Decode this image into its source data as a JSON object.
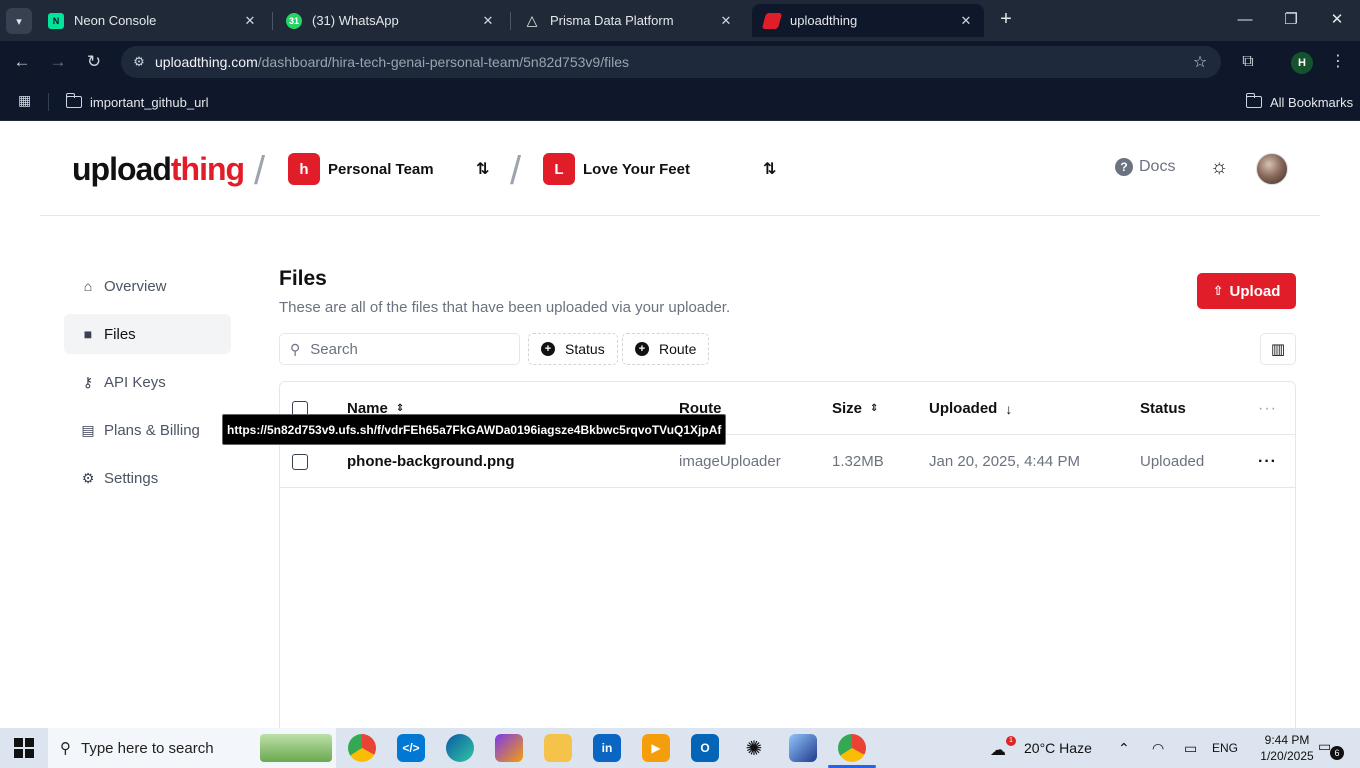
{
  "browser": {
    "tabs": [
      {
        "title": "Neon Console",
        "favicon": "N",
        "color": "#00e599"
      },
      {
        "title": "(31) WhatsApp",
        "favicon": "31",
        "color": "#25d366"
      },
      {
        "title": "Prisma Data Platform",
        "favicon": "P",
        "color": "#0f172a"
      },
      {
        "title": "uploadthing",
        "favicon": "U",
        "color": "#e11d2a"
      }
    ],
    "url_host": "uploadthing.com",
    "url_path": "/dashboard/hira-tech-genai-personal-team/5n82d753v9/files",
    "profile_initial": "H",
    "bookmarks": {
      "item": "important_github_url",
      "all": "All Bookmarks"
    }
  },
  "header": {
    "logo_main": "upload",
    "logo_accent": "thing",
    "team": {
      "initial": "h",
      "name": "Personal Team"
    },
    "app": {
      "initial": "L",
      "name": "Love Your Feet"
    },
    "docs": "Docs",
    "accent_color": "#e11d2a"
  },
  "sidebar": {
    "items": [
      {
        "label": "Overview",
        "icon": "home-icon",
        "active": false
      },
      {
        "label": "Files",
        "icon": "folder-icon",
        "active": true
      },
      {
        "label": "API Keys",
        "icon": "key-icon",
        "active": false
      },
      {
        "label": "Plans & Billing",
        "icon": "billing-icon",
        "active": false
      },
      {
        "label": "Settings",
        "icon": "gear-icon",
        "active": false
      }
    ]
  },
  "main": {
    "title": "Files",
    "subtitle": "These are all of the files that have been uploaded via your uploader.",
    "upload_label": "Upload",
    "search_placeholder": "Search",
    "filters": [
      "Status",
      "Route"
    ]
  },
  "table": {
    "columns": [
      "Name",
      "Route",
      "Size",
      "Uploaded",
      "Status"
    ],
    "rows": [
      {
        "name": "phone-background.png",
        "route": "imageUploader",
        "size": "1.32MB",
        "uploaded": "Jan 20, 2025, 4:44 PM",
        "status": "Uploaded"
      }
    ],
    "tooltip": "https://5n82d753v9.ufs.sh/f/vdrFEh65a7FkGAWDa0196iagsze4Bkbwc5rqvoTVuQ1XjpAf"
  },
  "taskbar": {
    "search_placeholder": "Type here to search",
    "weather": "20°C  Haze",
    "weather_badge": "1",
    "language": "ENG",
    "time": "9:44 PM",
    "date": "1/20/2025",
    "notifications": "6"
  }
}
